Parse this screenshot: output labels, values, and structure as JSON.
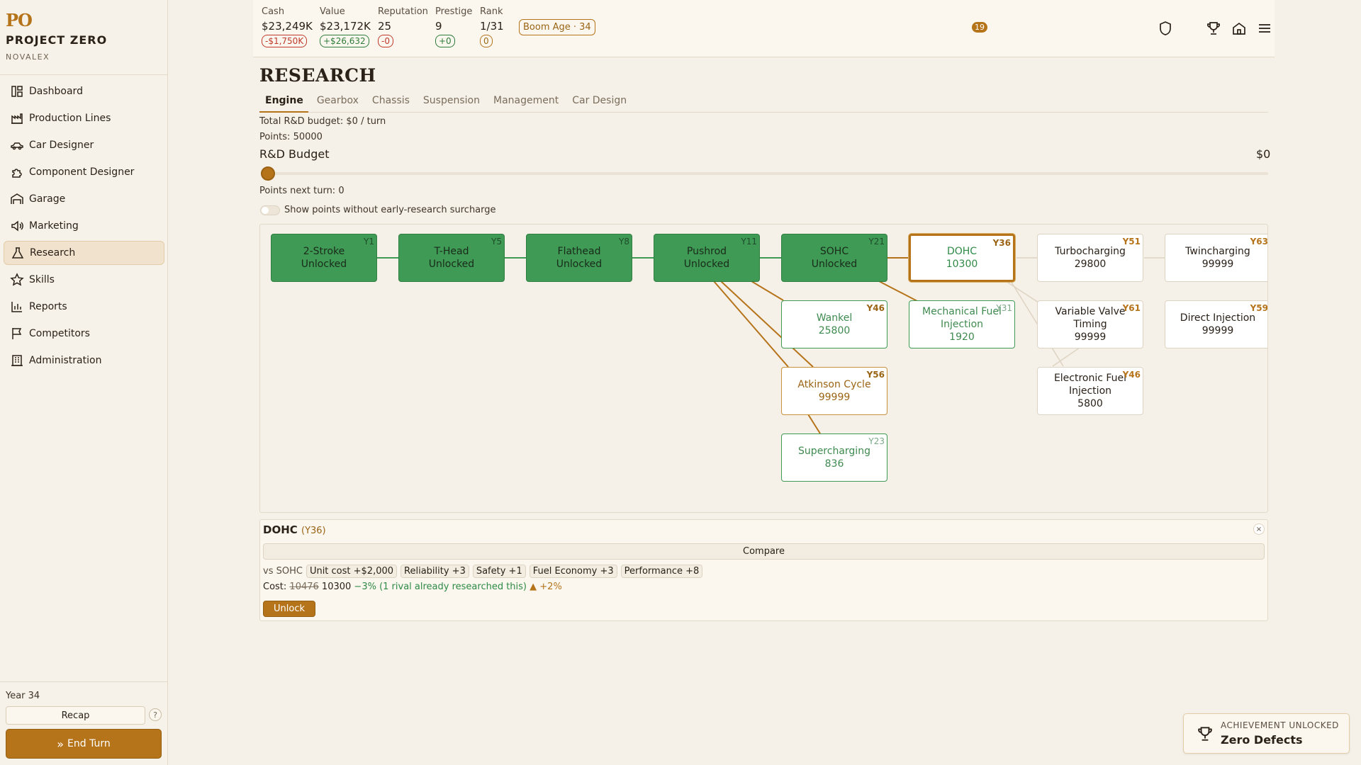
{
  "brand": {
    "mark": "PO",
    "title": "PROJECT ZERO",
    "subtitle": "NOVALEX"
  },
  "sidebar": {
    "items": [
      {
        "label": "Dashboard",
        "icon": "dashboard-icon"
      },
      {
        "label": "Production Lines",
        "icon": "factory-icon"
      },
      {
        "label": "Car Designer",
        "icon": "car-icon"
      },
      {
        "label": "Component Designer",
        "icon": "puzzle-icon"
      },
      {
        "label": "Garage",
        "icon": "garage-icon"
      },
      {
        "label": "Marketing",
        "icon": "megaphone-icon"
      },
      {
        "label": "Research",
        "icon": "flask-icon",
        "active": true
      },
      {
        "label": "Skills",
        "icon": "star-icon"
      },
      {
        "label": "Reports",
        "icon": "bar-chart-icon"
      },
      {
        "label": "Competitors",
        "icon": "flag-icon"
      },
      {
        "label": "Administration",
        "icon": "building-icon"
      }
    ],
    "year": "Year 34",
    "recap": "Recap",
    "help": "?",
    "end_turn": "End Turn"
  },
  "topbar": {
    "stats": [
      {
        "label": "Cash",
        "value": "$23,249K",
        "delta": "-$1,750K",
        "tone": "neg"
      },
      {
        "label": "Value",
        "value": "$23,172K",
        "delta": "+$26,632",
        "tone": "pos"
      },
      {
        "label": "Reputation",
        "value": "25",
        "delta": "-0",
        "tone": "neg"
      },
      {
        "label": "Prestige",
        "value": "9",
        "delta": "+0",
        "tone": "pos"
      },
      {
        "label": "Rank",
        "value": "1/31",
        "delta": "0",
        "tone": "neutral"
      }
    ],
    "era_badge": "Boom Age · 34",
    "shield_count": "19",
    "icons": [
      "shield-icon",
      "trophy-icon",
      "home-icon",
      "menu-icon"
    ]
  },
  "research": {
    "title": "RESEARCH",
    "tabs": [
      "Engine",
      "Gearbox",
      "Chassis",
      "Suspension",
      "Management",
      "Car Design"
    ],
    "active_tab": "Engine",
    "budget_total": "Total R&D budget: $0 / turn",
    "points": "Points: 50000",
    "budget_label": "R&D Budget",
    "budget_value": "$0",
    "slider_level": 0,
    "points_next": "Points next turn: 0",
    "toggle_label": "Show points without early-research surcharge",
    "toggle_on": false
  },
  "tree": {
    "nodes": [
      {
        "id": "2stroke",
        "name": "2-Stroke",
        "sub": "Unlocked",
        "year": "Y1",
        "state": "unlocked"
      },
      {
        "id": "thead",
        "name": "T-Head",
        "sub": "Unlocked",
        "year": "Y5",
        "state": "unlocked"
      },
      {
        "id": "flathead",
        "name": "Flathead",
        "sub": "Unlocked",
        "year": "Y8",
        "state": "unlocked"
      },
      {
        "id": "pushrod",
        "name": "Pushrod",
        "sub": "Unlocked",
        "year": "Y11",
        "state": "unlocked"
      },
      {
        "id": "sohc",
        "name": "SOHC",
        "sub": "Unlocked",
        "year": "Y21",
        "state": "unlocked"
      },
      {
        "id": "dohc",
        "name": "DOHC",
        "sub": "10300",
        "year": "Y36",
        "state": "selected"
      },
      {
        "id": "turbo",
        "name": "Turbocharging",
        "sub": "29800",
        "year": "Y51",
        "state": "locked"
      },
      {
        "id": "twin",
        "name": "Twincharging",
        "sub": "99999",
        "year": "Y63",
        "state": "locked"
      },
      {
        "id": "wankel",
        "name": "Wankel",
        "sub": "25800",
        "year": "Y46",
        "state": "avail-y"
      },
      {
        "id": "mfi",
        "name": "Mechanical Fuel Injection",
        "sub": "1920",
        "year": "Y31",
        "state": "avail"
      },
      {
        "id": "vvt",
        "name": "Variable Valve Timing",
        "sub": "99999",
        "year": "Y61",
        "state": "locked"
      },
      {
        "id": "di",
        "name": "Direct Injection",
        "sub": "99999",
        "year": "Y59",
        "state": "locked"
      },
      {
        "id": "atkinson",
        "name": "Atkinson Cycle",
        "sub": "99999",
        "year": "Y56",
        "state": "warn"
      },
      {
        "id": "efi",
        "name": "Electronic Fuel Injection",
        "sub": "5800",
        "year": "Y46",
        "state": "locked"
      },
      {
        "id": "super",
        "name": "Supercharging",
        "sub": "836",
        "year": "Y23",
        "state": "avail"
      }
    ]
  },
  "detail": {
    "name": "DOHC",
    "year": "(Y36)",
    "close": "×",
    "compare": "Compare",
    "vs": "vs SOHC",
    "chips": [
      "Unit cost +$2,000",
      "Reliability +3",
      "Safety +1",
      "Fuel Economy +3",
      "Performance +8"
    ],
    "cost_label": "Cost:",
    "cost_old": "10476",
    "cost_new": "10300",
    "cost_discount": "−3% (1 rival already researched this)",
    "cost_surcharge": "▲ +2%",
    "unlock": "Unlock"
  },
  "toast": {
    "kicker": "ACHIEVEMENT UNLOCKED",
    "title": "Zero Defects",
    "icon": "trophy-icon"
  },
  "colors": {
    "accent": "#b5741a",
    "unlocked": "#3e9a54",
    "background": "#f6f1e8"
  }
}
